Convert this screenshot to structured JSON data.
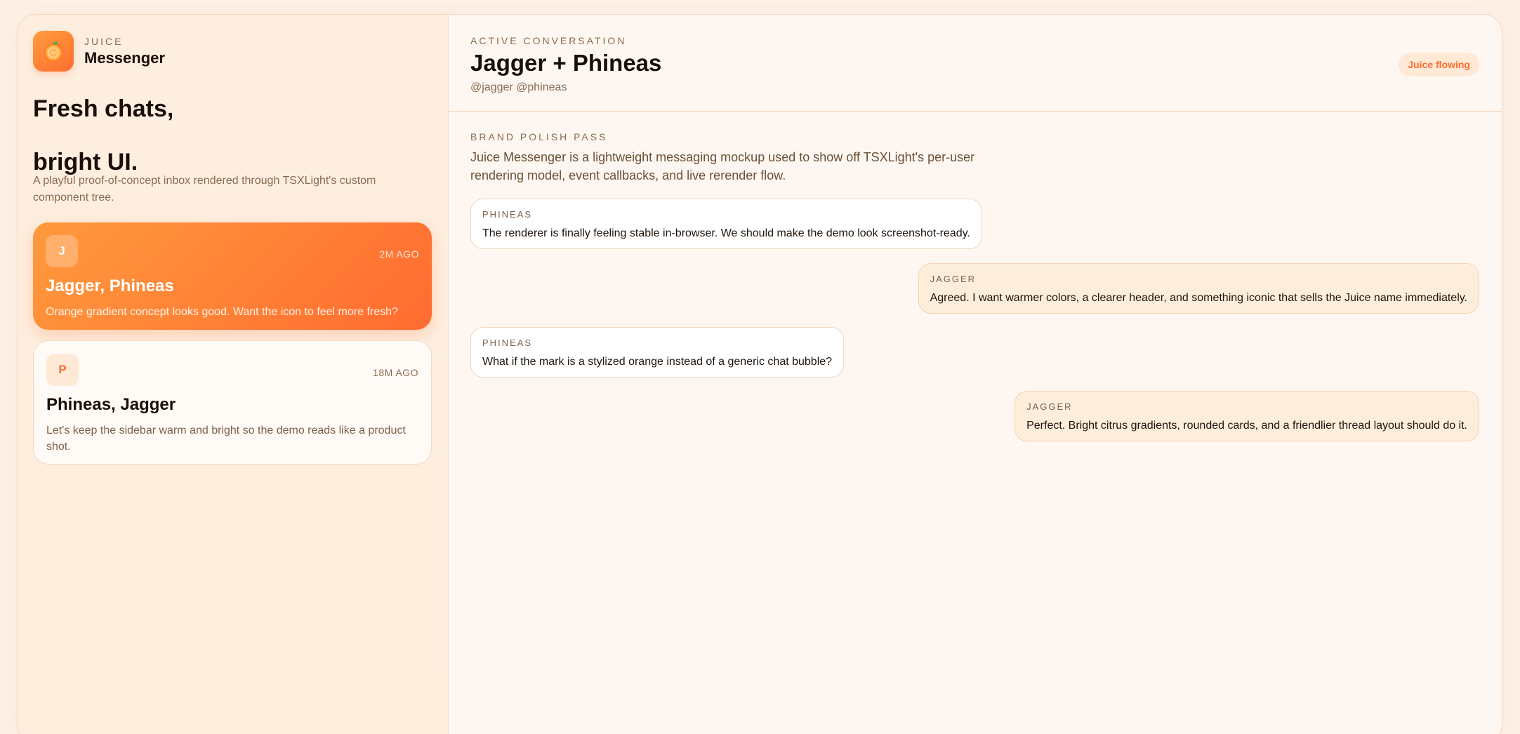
{
  "brand": {
    "kicker": "Juice",
    "name": "Messenger",
    "logo_icon": "orange-icon"
  },
  "sidebar": {
    "headline_line1": "Fresh chats,",
    "headline_line2": "bright UI.",
    "subtitle": "A playful proof-of-concept inbox rendered through TSXLight's custom component tree.",
    "conversations": [
      {
        "avatar": "J",
        "time": "2m ago",
        "title": "Jagger, Phineas",
        "preview": "Orange gradient concept looks good. Want the icon to feel more fresh?",
        "active": true
      },
      {
        "avatar": "P",
        "time": "18m ago",
        "title": "Phineas, Jagger",
        "preview": "Let's keep the sidebar warm and bright so the demo reads like a product shot.",
        "active": false
      }
    ]
  },
  "header": {
    "kicker": "Active conversation",
    "title": "Jagger + Phineas",
    "handles": "@jagger @phineas",
    "status": "Juice flowing"
  },
  "thread": {
    "kicker": "Brand polish pass",
    "description": "Juice Messenger is a lightweight messaging mockup used to show off TSXLight's per-user rendering model, event callbacks, and live rerender flow.",
    "messages": [
      {
        "author": "Phineas",
        "text": "The renderer is finally feeling stable in-browser. We should make the demo look screenshot-ready.",
        "side": "left"
      },
      {
        "author": "Jagger",
        "text": "Agreed. I want warmer colors, a clearer header, and something iconic that sells the Juice name immediately.",
        "side": "right"
      },
      {
        "author": "Phineas",
        "text": "What if the mark is a stylized orange instead of a generic chat bubble?",
        "side": "left"
      },
      {
        "author": "Jagger",
        "text": "Perfect. Bright citrus gradients, rounded cards, and a friendlier thread layout should do it.",
        "side": "right"
      }
    ]
  },
  "colors": {
    "accent": "#ff6b2e",
    "accent_light": "#ff9a3d",
    "background": "#fef7f1"
  }
}
